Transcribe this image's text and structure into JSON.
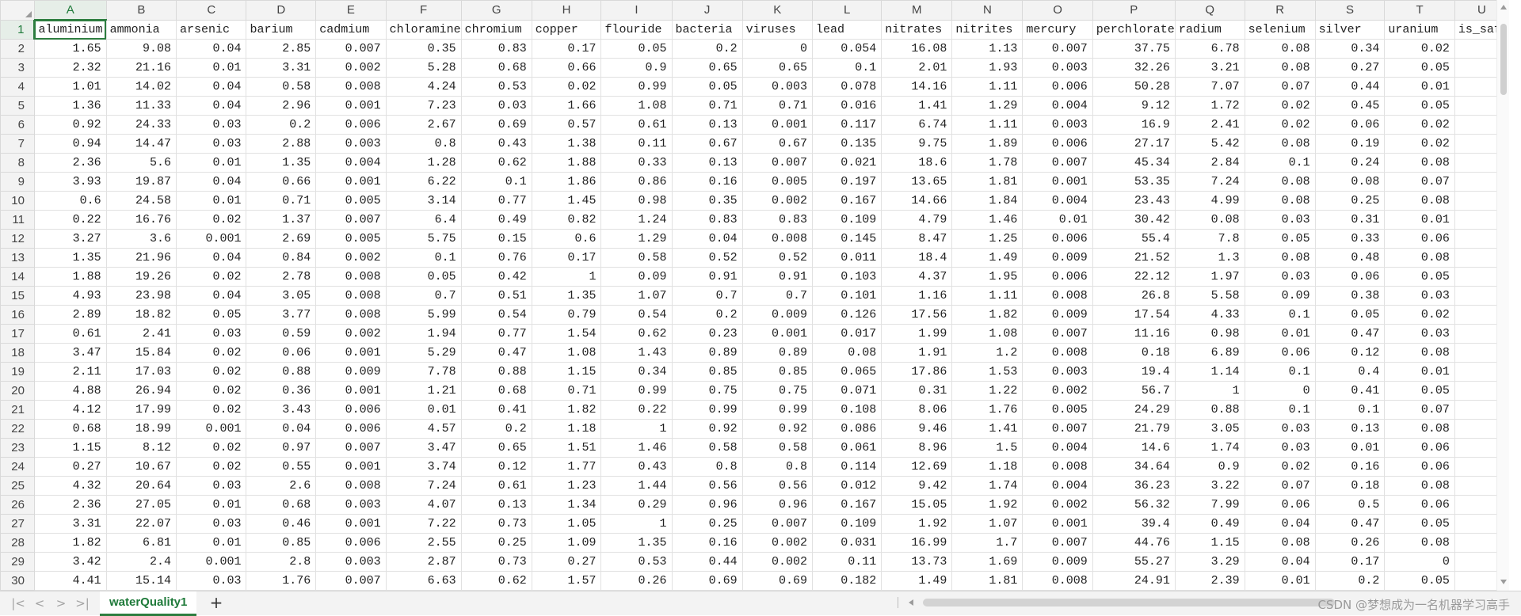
{
  "columns": [
    "A",
    "B",
    "C",
    "D",
    "E",
    "F",
    "G",
    "H",
    "I",
    "J",
    "K",
    "L",
    "M",
    "N",
    "O",
    "P",
    "Q",
    "R",
    "S",
    "T",
    "U"
  ],
  "headers": [
    "aluminium",
    "ammonia",
    "arsenic",
    "barium",
    "cadmium",
    "chloramine",
    "chromium",
    "copper",
    "flouride",
    "bacteria",
    "viruses",
    "lead",
    "nitrates",
    "nitrites",
    "mercury",
    "perchlorate",
    "radium",
    "selenium",
    "silver",
    "uranium",
    "is_safe"
  ],
  "rows": [
    [
      "1.65",
      "9.08",
      "0.04",
      "2.85",
      "0.007",
      "0.35",
      "0.83",
      "0.17",
      "0.05",
      "0.2",
      "0",
      "0.054",
      "16.08",
      "1.13",
      "0.007",
      "37.75",
      "6.78",
      "0.08",
      "0.34",
      "0.02",
      ""
    ],
    [
      "2.32",
      "21.16",
      "0.01",
      "3.31",
      "0.002",
      "5.28",
      "0.68",
      "0.66",
      "0.9",
      "0.65",
      "0.65",
      "0.1",
      "2.01",
      "1.93",
      "0.003",
      "32.26",
      "3.21",
      "0.08",
      "0.27",
      "0.05",
      ""
    ],
    [
      "1.01",
      "14.02",
      "0.04",
      "0.58",
      "0.008",
      "4.24",
      "0.53",
      "0.02",
      "0.99",
      "0.05",
      "0.003",
      "0.078",
      "14.16",
      "1.11",
      "0.006",
      "50.28",
      "7.07",
      "0.07",
      "0.44",
      "0.01",
      ""
    ],
    [
      "1.36",
      "11.33",
      "0.04",
      "2.96",
      "0.001",
      "7.23",
      "0.03",
      "1.66",
      "1.08",
      "0.71",
      "0.71",
      "0.016",
      "1.41",
      "1.29",
      "0.004",
      "9.12",
      "1.72",
      "0.02",
      "0.45",
      "0.05",
      ""
    ],
    [
      "0.92",
      "24.33",
      "0.03",
      "0.2",
      "0.006",
      "2.67",
      "0.69",
      "0.57",
      "0.61",
      "0.13",
      "0.001",
      "0.117",
      "6.74",
      "1.11",
      "0.003",
      "16.9",
      "2.41",
      "0.02",
      "0.06",
      "0.02",
      ""
    ],
    [
      "0.94",
      "14.47",
      "0.03",
      "2.88",
      "0.003",
      "0.8",
      "0.43",
      "1.38",
      "0.11",
      "0.67",
      "0.67",
      "0.135",
      "9.75",
      "1.89",
      "0.006",
      "27.17",
      "5.42",
      "0.08",
      "0.19",
      "0.02",
      ""
    ],
    [
      "2.36",
      "5.6",
      "0.01",
      "1.35",
      "0.004",
      "1.28",
      "0.62",
      "1.88",
      "0.33",
      "0.13",
      "0.007",
      "0.021",
      "18.6",
      "1.78",
      "0.007",
      "45.34",
      "2.84",
      "0.1",
      "0.24",
      "0.08",
      ""
    ],
    [
      "3.93",
      "19.87",
      "0.04",
      "0.66",
      "0.001",
      "6.22",
      "0.1",
      "1.86",
      "0.86",
      "0.16",
      "0.005",
      "0.197",
      "13.65",
      "1.81",
      "0.001",
      "53.35",
      "7.24",
      "0.08",
      "0.08",
      "0.07",
      ""
    ],
    [
      "0.6",
      "24.58",
      "0.01",
      "0.71",
      "0.005",
      "3.14",
      "0.77",
      "1.45",
      "0.98",
      "0.35",
      "0.002",
      "0.167",
      "14.66",
      "1.84",
      "0.004",
      "23.43",
      "4.99",
      "0.08",
      "0.25",
      "0.08",
      ""
    ],
    [
      "0.22",
      "16.76",
      "0.02",
      "1.37",
      "0.007",
      "6.4",
      "0.49",
      "0.82",
      "1.24",
      "0.83",
      "0.83",
      "0.109",
      "4.79",
      "1.46",
      "0.01",
      "30.42",
      "0.08",
      "0.03",
      "0.31",
      "0.01",
      ""
    ],
    [
      "3.27",
      "3.6",
      "0.001",
      "2.69",
      "0.005",
      "5.75",
      "0.15",
      "0.6",
      "1.29",
      "0.04",
      "0.008",
      "0.145",
      "8.47",
      "1.25",
      "0.006",
      "55.4",
      "7.8",
      "0.05",
      "0.33",
      "0.06",
      ""
    ],
    [
      "1.35",
      "21.96",
      "0.04",
      "0.84",
      "0.002",
      "0.1",
      "0.76",
      "0.17",
      "0.58",
      "0.52",
      "0.52",
      "0.011",
      "18.4",
      "1.49",
      "0.009",
      "21.52",
      "1.3",
      "0.08",
      "0.48",
      "0.08",
      ""
    ],
    [
      "1.88",
      "19.26",
      "0.02",
      "2.78",
      "0.008",
      "0.05",
      "0.42",
      "1",
      "0.09",
      "0.91",
      "0.91",
      "0.103",
      "4.37",
      "1.95",
      "0.006",
      "22.12",
      "1.97",
      "0.03",
      "0.06",
      "0.05",
      ""
    ],
    [
      "4.93",
      "23.98",
      "0.04",
      "3.05",
      "0.008",
      "0.7",
      "0.51",
      "1.35",
      "1.07",
      "0.7",
      "0.7",
      "0.101",
      "1.16",
      "1.11",
      "0.008",
      "26.8",
      "5.58",
      "0.09",
      "0.38",
      "0.03",
      ""
    ],
    [
      "2.89",
      "18.82",
      "0.05",
      "3.77",
      "0.008",
      "5.99",
      "0.54",
      "0.79",
      "0.54",
      "0.2",
      "0.009",
      "0.126",
      "17.56",
      "1.82",
      "0.009",
      "17.54",
      "4.33",
      "0.1",
      "0.05",
      "0.02",
      ""
    ],
    [
      "0.61",
      "2.41",
      "0.03",
      "0.59",
      "0.002",
      "1.94",
      "0.77",
      "1.54",
      "0.62",
      "0.23",
      "0.001",
      "0.017",
      "1.99",
      "1.08",
      "0.007",
      "11.16",
      "0.98",
      "0.01",
      "0.47",
      "0.03",
      ""
    ],
    [
      "3.47",
      "15.84",
      "0.02",
      "0.06",
      "0.001",
      "5.29",
      "0.47",
      "1.08",
      "1.43",
      "0.89",
      "0.89",
      "0.08",
      "1.91",
      "1.2",
      "0.008",
      "0.18",
      "6.89",
      "0.06",
      "0.12",
      "0.08",
      ""
    ],
    [
      "2.11",
      "17.03",
      "0.02",
      "0.88",
      "0.009",
      "7.78",
      "0.88",
      "1.15",
      "0.34",
      "0.85",
      "0.85",
      "0.065",
      "17.86",
      "1.53",
      "0.003",
      "19.4",
      "1.14",
      "0.1",
      "0.4",
      "0.01",
      ""
    ],
    [
      "4.88",
      "26.94",
      "0.02",
      "0.36",
      "0.001",
      "1.21",
      "0.68",
      "0.71",
      "0.99",
      "0.75",
      "0.75",
      "0.071",
      "0.31",
      "1.22",
      "0.002",
      "56.7",
      "1",
      "0",
      "0.41",
      "0.05",
      ""
    ],
    [
      "4.12",
      "17.99",
      "0.02",
      "3.43",
      "0.006",
      "0.01",
      "0.41",
      "1.82",
      "0.22",
      "0.99",
      "0.99",
      "0.108",
      "8.06",
      "1.76",
      "0.005",
      "24.29",
      "0.88",
      "0.1",
      "0.1",
      "0.07",
      ""
    ],
    [
      "0.68",
      "18.99",
      "0.001",
      "0.04",
      "0.006",
      "4.57",
      "0.2",
      "1.18",
      "1",
      "0.92",
      "0.92",
      "0.086",
      "9.46",
      "1.41",
      "0.007",
      "21.79",
      "3.05",
      "0.03",
      "0.13",
      "0.08",
      ""
    ],
    [
      "1.15",
      "8.12",
      "0.02",
      "0.97",
      "0.007",
      "3.47",
      "0.65",
      "1.51",
      "1.46",
      "0.58",
      "0.58",
      "0.061",
      "8.96",
      "1.5",
      "0.004",
      "14.6",
      "1.74",
      "0.03",
      "0.01",
      "0.06",
      ""
    ],
    [
      "0.27",
      "10.67",
      "0.02",
      "0.55",
      "0.001",
      "3.74",
      "0.12",
      "1.77",
      "0.43",
      "0.8",
      "0.8",
      "0.114",
      "12.69",
      "1.18",
      "0.008",
      "34.64",
      "0.9",
      "0.02",
      "0.16",
      "0.06",
      ""
    ],
    [
      "4.32",
      "20.64",
      "0.03",
      "2.6",
      "0.008",
      "7.24",
      "0.61",
      "1.23",
      "1.44",
      "0.56",
      "0.56",
      "0.012",
      "9.42",
      "1.74",
      "0.004",
      "36.23",
      "3.22",
      "0.07",
      "0.18",
      "0.08",
      ""
    ],
    [
      "2.36",
      "27.05",
      "0.01",
      "0.68",
      "0.003",
      "4.07",
      "0.13",
      "1.34",
      "0.29",
      "0.96",
      "0.96",
      "0.167",
      "15.05",
      "1.92",
      "0.002",
      "56.32",
      "7.99",
      "0.06",
      "0.5",
      "0.06",
      ""
    ],
    [
      "3.31",
      "22.07",
      "0.03",
      "0.46",
      "0.001",
      "7.22",
      "0.73",
      "1.05",
      "1",
      "0.25",
      "0.007",
      "0.109",
      "1.92",
      "1.07",
      "0.001",
      "39.4",
      "0.49",
      "0.04",
      "0.47",
      "0.05",
      ""
    ],
    [
      "1.82",
      "6.81",
      "0.01",
      "0.85",
      "0.006",
      "2.55",
      "0.25",
      "1.09",
      "1.35",
      "0.16",
      "0.002",
      "0.031",
      "16.99",
      "1.7",
      "0.007",
      "44.76",
      "1.15",
      "0.08",
      "0.26",
      "0.08",
      ""
    ],
    [
      "3.42",
      "2.4",
      "0.001",
      "2.8",
      "0.003",
      "2.87",
      "0.73",
      "0.27",
      "0.53",
      "0.44",
      "0.002",
      "0.11",
      "13.73",
      "1.69",
      "0.009",
      "55.27",
      "3.29",
      "0.04",
      "0.17",
      "0",
      ""
    ],
    [
      "4.41",
      "15.14",
      "0.03",
      "1.76",
      "0.007",
      "6.63",
      "0.62",
      "1.57",
      "0.26",
      "0.69",
      "0.69",
      "0.182",
      "1.49",
      "1.81",
      "0.008",
      "24.91",
      "2.39",
      "0.01",
      "0.2",
      "0.05",
      ""
    ]
  ],
  "first_row_number": 1,
  "sheet_tab": "waterQuality1",
  "add_sheet_label": "+",
  "nav": {
    "first": "|<",
    "prev": "<",
    "next": ">",
    "last": ">|"
  },
  "watermark": "CSDN @梦想成为一名机器学习高手",
  "accent_color": "#2d7d3f",
  "selected_cell": "A1"
}
